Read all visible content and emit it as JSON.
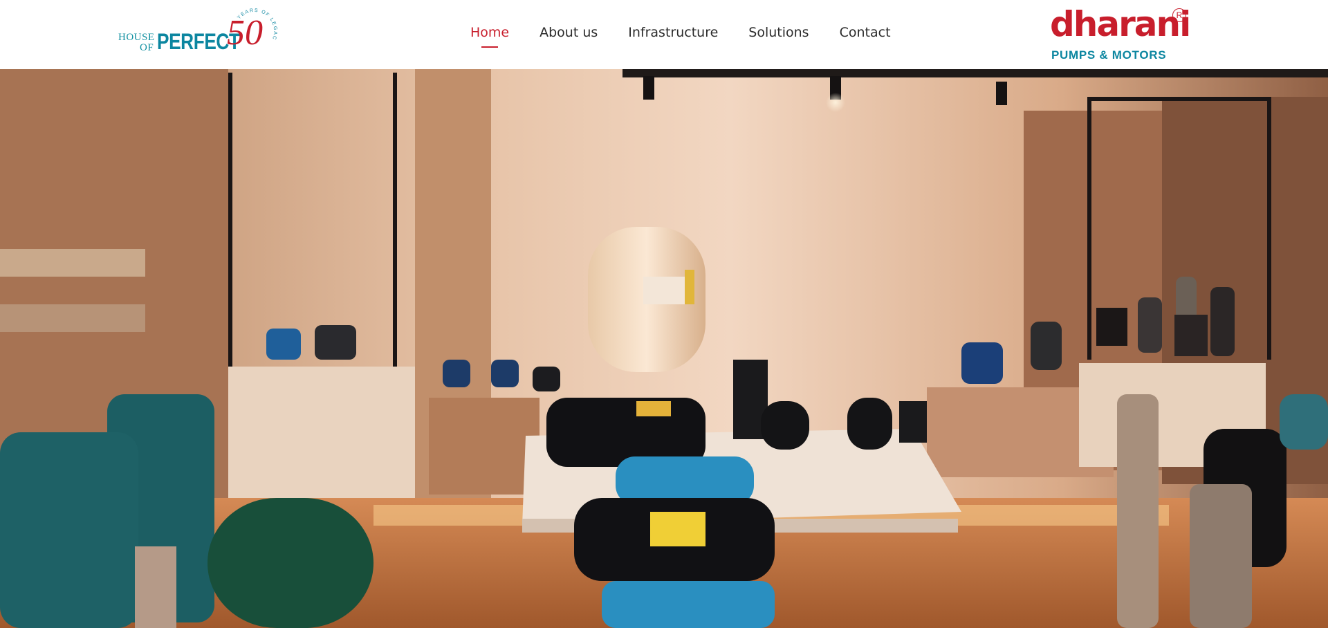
{
  "brand_left": {
    "line1": "HOUSE",
    "line2": "OF",
    "word": "PERFECT",
    "number": "50",
    "arc_text": "YEARS OF LEGACY"
  },
  "nav": {
    "items": [
      {
        "label": "Home",
        "active": true
      },
      {
        "label": "About us",
        "active": false
      },
      {
        "label": "Infrastructure",
        "active": false
      },
      {
        "label": "Solutions",
        "active": false
      },
      {
        "label": "Contact",
        "active": false
      }
    ]
  },
  "brand_right": {
    "name": "dharani",
    "registered": "R",
    "tagline": "PUMPS & MOTORS"
  },
  "colors": {
    "brand_red": "#c81e2c",
    "brand_teal": "#0c86a0",
    "nav_text": "#2b2b2b"
  },
  "hero": {
    "content": "showroom video background"
  }
}
